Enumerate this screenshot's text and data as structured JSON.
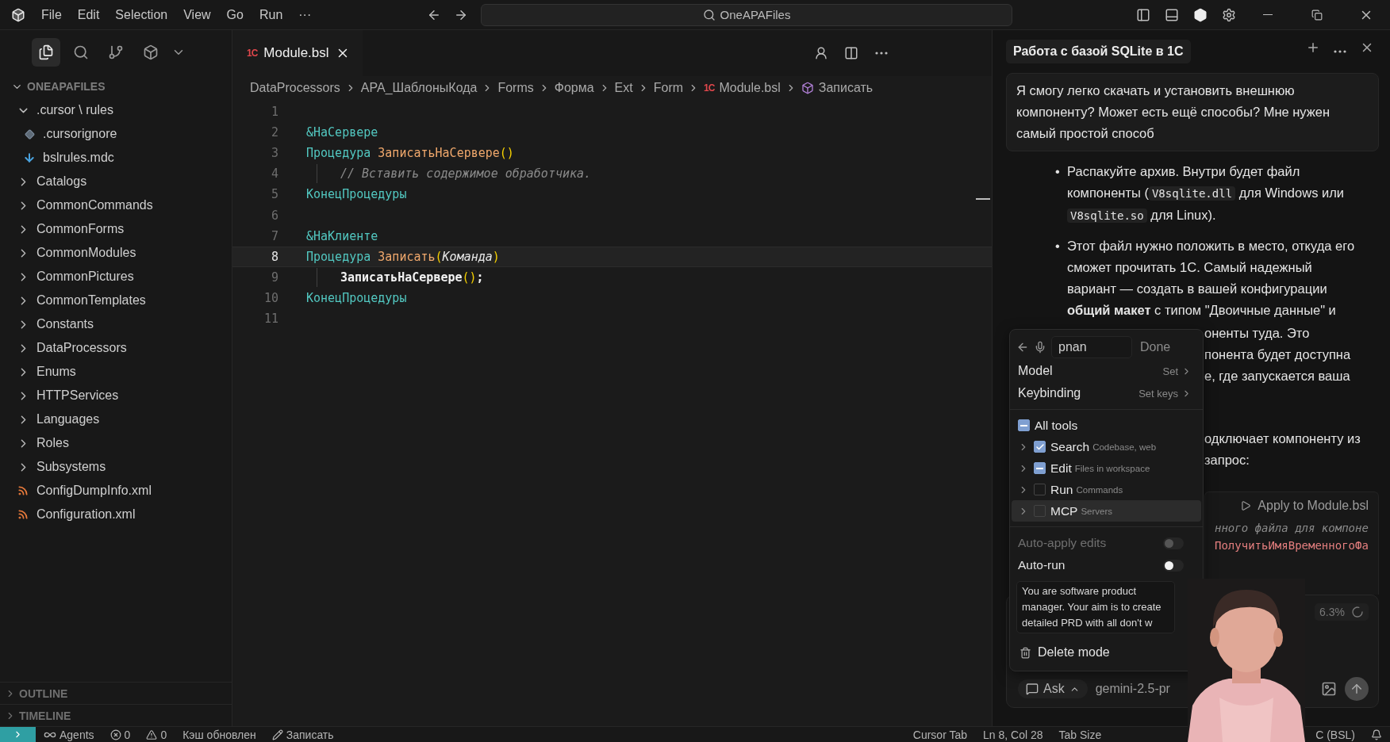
{
  "titlebar": {
    "menus": [
      "File",
      "Edit",
      "Selection",
      "View",
      "Go",
      "Run",
      "···"
    ],
    "search": "OneAPAFiles"
  },
  "sidebar": {
    "views": [
      {
        "selected": true
      },
      {
        "selected": false
      },
      {
        "selected": false
      },
      {
        "selected": false
      }
    ]
  },
  "explorer": {
    "title": "ONEAPAFILES",
    "expanded": true,
    "items": [
      {
        "label": ".cursor \\ rules",
        "kind": "folder",
        "expanded": true,
        "children": [
          {
            "label": ".cursorignore",
            "kind": "ignore"
          },
          {
            "label": "bslrules.mdc",
            "kind": "markdown"
          }
        ]
      },
      {
        "label": "Catalogs",
        "kind": "folder",
        "expanded": false
      },
      {
        "label": "CommonCommands",
        "kind": "folder",
        "expanded": false
      },
      {
        "label": "CommonForms",
        "kind": "folder",
        "expanded": false
      },
      {
        "label": "CommonModules",
        "kind": "folder",
        "expanded": false
      },
      {
        "label": "CommonPictures",
        "kind": "folder",
        "expanded": false
      },
      {
        "label": "CommonTemplates",
        "kind": "folder",
        "expanded": false
      },
      {
        "label": "Constants",
        "kind": "folder",
        "expanded": false
      },
      {
        "label": "DataProcessors",
        "kind": "folder",
        "expanded": false
      },
      {
        "label": "Enums",
        "kind": "folder",
        "expanded": false
      },
      {
        "label": "HTTPServices",
        "kind": "folder",
        "expanded": false
      },
      {
        "label": "Languages",
        "kind": "folder",
        "expanded": false
      },
      {
        "label": "Roles",
        "kind": "folder",
        "expanded": false
      },
      {
        "label": "Subsystems",
        "kind": "folder",
        "expanded": false
      },
      {
        "label": "ConfigDumpInfo.xml",
        "kind": "xml"
      },
      {
        "label": "Configuration.xml",
        "kind": "xml"
      }
    ]
  },
  "sections": [
    {
      "label": "OUTLINE",
      "expanded": false
    },
    {
      "label": "TIMELINE",
      "expanded": false
    }
  ],
  "editor": {
    "tabs": [
      {
        "label": "Module.bsl",
        "badge": "1С",
        "selected": true
      }
    ],
    "breadcrumbs": [
      {
        "label": "DataProcessors",
        "kind": "plain"
      },
      {
        "label": "APA_ШаблоныКода",
        "kind": "plain"
      },
      {
        "label": "Forms",
        "kind": "plain"
      },
      {
        "label": "Форма",
        "kind": "plain"
      },
      {
        "label": "Ext",
        "kind": "plain"
      },
      {
        "label": "Form",
        "kind": "plain"
      },
      {
        "label": "Module.bsl",
        "kind": "file",
        "badge": "1С"
      },
      {
        "label": "Записать",
        "kind": "symbol"
      }
    ],
    "lines": [
      {
        "number": "1",
        "current": false,
        "indented": false
      },
      {
        "number": "2",
        "current": false,
        "indented": false,
        "tokens": [
          {
            "kind": "annotation",
            "text": "&НаСервере"
          }
        ]
      },
      {
        "number": "3",
        "current": false,
        "indented": false,
        "tokens": [
          {
            "kind": "keyword",
            "text": "Процедура "
          },
          {
            "kind": "function",
            "text": "ЗаписатьНаСервере"
          },
          {
            "kind": "paren",
            "text": "()"
          }
        ]
      },
      {
        "number": "4",
        "current": false,
        "indented": true,
        "tokens": [
          {
            "kind": "comment",
            "text": "// Вставить содержимое обработчика."
          }
        ]
      },
      {
        "number": "5",
        "current": false,
        "indented": false,
        "tokens": [
          {
            "kind": "keyword",
            "text": "КонецПроцедуры"
          }
        ]
      },
      {
        "number": "6",
        "current": false,
        "indented": false
      },
      {
        "number": "7",
        "current": false,
        "indented": false,
        "tokens": [
          {
            "kind": "annotation",
            "text": "&НаКлиенте"
          }
        ]
      },
      {
        "number": "8",
        "current": true,
        "indented": false,
        "tokens": [
          {
            "kind": "keyword",
            "text": "Процедура "
          },
          {
            "kind": "function",
            "text": "Записать"
          },
          {
            "kind": "paren",
            "text": "("
          },
          {
            "kind": "param",
            "text": "Команда"
          },
          {
            "kind": "paren",
            "text": ")"
          }
        ]
      },
      {
        "number": "9",
        "current": false,
        "indented": true,
        "tokens": [
          {
            "kind": "plain",
            "text": "ЗаписатьНаСервере"
          },
          {
            "kind": "paren",
            "text": "()"
          },
          {
            "kind": "plain",
            "text": ";"
          }
        ]
      },
      {
        "number": "10",
        "current": false,
        "indented": false,
        "tokens": [
          {
            "kind": "keyword",
            "text": "КонецПроцедуры"
          }
        ]
      },
      {
        "number": "11",
        "current": false,
        "indented": false
      }
    ]
  },
  "chat": {
    "title": "Работа с базой SQLite в 1С",
    "message": "Я смогу легко скачать и установить внешнюю компоненту? Может есть ещё способы? Мне нужен самый простой способ",
    "bullets": [
      {
        "marker": "•",
        "segments": [
          {
            "kind": "text",
            "text": "Распакуйте архив. Внутри будет файл компоненты ("
          },
          {
            "kind": "code",
            "text": "V8sqlite.dll"
          },
          {
            "kind": "text",
            "text": " для Windows или "
          },
          {
            "kind": "code",
            "text": "V8sqlite.so"
          },
          {
            "kind": "text",
            "text": " для Linux)."
          }
        ]
      },
      {
        "marker": "•",
        "segments": [
          {
            "kind": "text",
            "text": "Этот файл нужно положить в место, откуда его сможет прочитать 1С. Самый надежный вариант — создать в вашей конфигурации **общий макет** с типом \"Двоичные данные\" и"
          }
        ]
      }
    ],
    "fragments": [
      [
        "оненты туда. Это",
        "понента будет доступна",
        "е, где запускается ваша"
      ],
      [
        "одключает компоненту из",
        "запрос:"
      ]
    ],
    "code_block": {
      "action": "Apply to Module.bsl",
      "lines": [
        {
          "kind": "comment",
          "text": "нного файла для компоне"
        },
        {
          "kind": "function",
          "text": "ПолучитьИмяВременногоФа"
        }
      ]
    }
  },
  "popup": {
    "search": {
      "value": "pnan"
    },
    "done": "Done",
    "rows": [
      {
        "label": "Model",
        "value": "Set"
      },
      {
        "label": "Keybinding",
        "value": "Set keys"
      }
    ],
    "all_tools": {
      "label": "All tools",
      "checked": true,
      "indeterminate": true
    },
    "tools": [
      {
        "name": "Search",
        "hint": "Codebase, web",
        "checked": true,
        "indeterminate": false,
        "selected": false
      },
      {
        "name": "Edit",
        "hint": "Files in workspace",
        "checked": true,
        "indeterminate": true,
        "selected": false
      },
      {
        "name": "Run",
        "hint": "Commands",
        "checked": false,
        "indeterminate": false,
        "selected": false
      },
      {
        "name": "MCP",
        "hint": "Servers",
        "checked": false,
        "indeterminate": false,
        "selected": true
      }
    ],
    "toggles": [
      {
        "label": "Auto-apply edits",
        "on": false,
        "disabled": true
      },
      {
        "label": "Auto-run",
        "on": false,
        "disabled": false
      }
    ],
    "instructions": {
      "value": "You are software product manager. Your aim is to create detailed PRD with all don't w"
    },
    "delete": "Delete mode"
  },
  "composer": {
    "usage": "6.3%",
    "mode": "Ask",
    "model": "gemini-2.5-pr"
  },
  "statusbar": {
    "left": [
      {
        "kind": "agents",
        "text": "Agents"
      },
      {
        "kind": "errors",
        "text": "0"
      },
      {
        "kind": "warnings",
        "text": "0"
      },
      {
        "kind": "plain",
        "text": "Кэш обновлен"
      },
      {
        "kind": "edit",
        "text": "Записать"
      }
    ],
    "right": [
      "Cursor Tab",
      "Ln 8, Col 28",
      "Tab Size"
    ],
    "language": "C (BSL)"
  }
}
